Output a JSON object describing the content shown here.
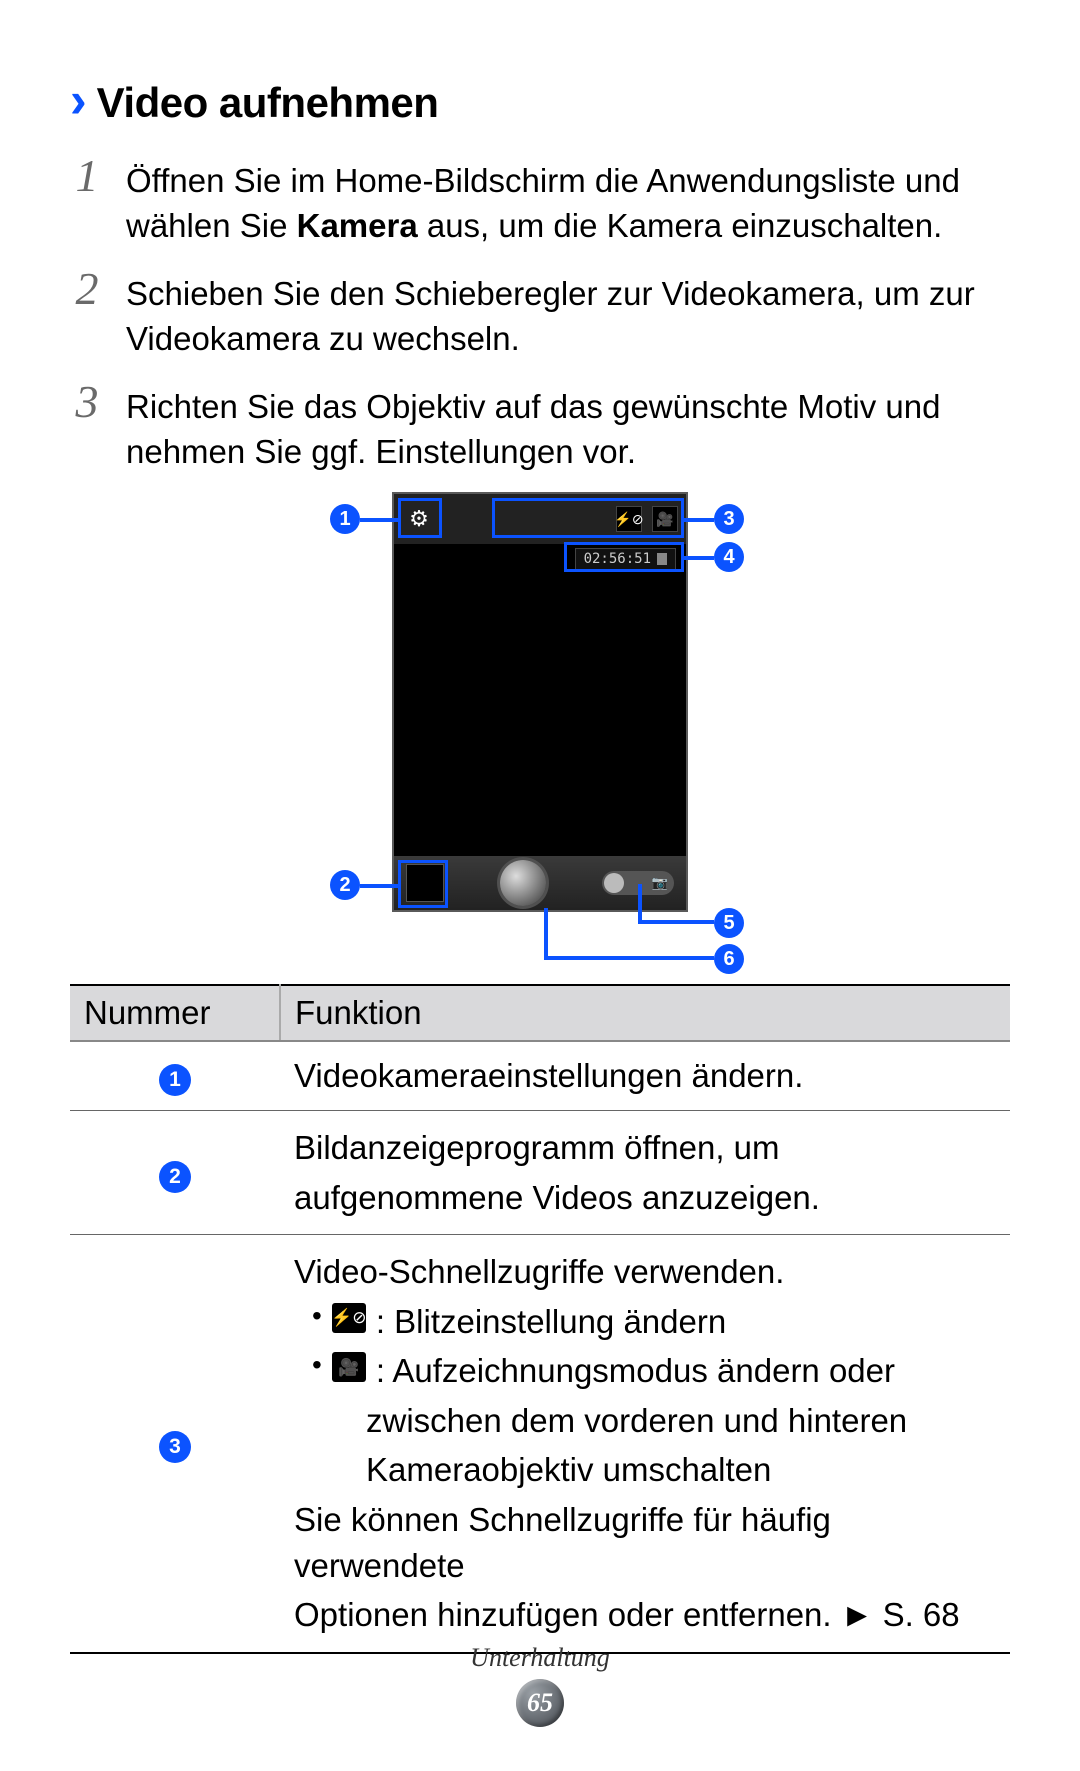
{
  "heading": "Video aufnehmen",
  "steps": [
    {
      "num": "1",
      "pre": "Öffnen Sie im Home-Bildschirm die Anwendungsliste und wählen Sie ",
      "bold": "Kamera",
      "post": " aus, um die Kamera einzuschalten."
    },
    {
      "num": "2",
      "pre": "Schieben Sie den Schieberegler zur Videokamera, um zur Videokamera zu wechseln.",
      "bold": "",
      "post": ""
    },
    {
      "num": "3",
      "pre": "Richten Sie das Objektiv auf das gewünschte Motiv und nehmen Sie ggf. Einstellungen vor.",
      "bold": "",
      "post": ""
    }
  ],
  "figure": {
    "timecode": "02:56:51",
    "callouts": {
      "c1": "1",
      "c2": "2",
      "c3": "3",
      "c4": "4",
      "c5": "5",
      "c6": "6"
    }
  },
  "table": {
    "headers": {
      "num": "Nummer",
      "func": "Funktion"
    },
    "rows": {
      "r1": {
        "badge": "1",
        "text": "Videokameraeinstellungen ändern."
      },
      "r2": {
        "badge": "2",
        "line1": "Bildanzeigeprogramm öffnen, um",
        "line2": "aufgenommene Videos anzuzeigen."
      },
      "r3": {
        "badge": "3",
        "intro": "Video-Schnellzugriffe verwenden.",
        "b1": ": Blitzeinstellung ändern",
        "b2a": ": Aufzeichnungsmodus ändern oder",
        "b2b": "zwischen dem vorderen und hinteren",
        "b2c": "Kameraobjektiv umschalten",
        "out1": "Sie können Schnellzugriffe für häufig verwendete",
        "out2": "Optionen hinzufügen oder entfernen. ► S. 68"
      }
    }
  },
  "footer": {
    "section": "Unterhaltung",
    "page": "65"
  },
  "icons": {
    "flash": "⚡⊘",
    "videocam": "🎥"
  }
}
